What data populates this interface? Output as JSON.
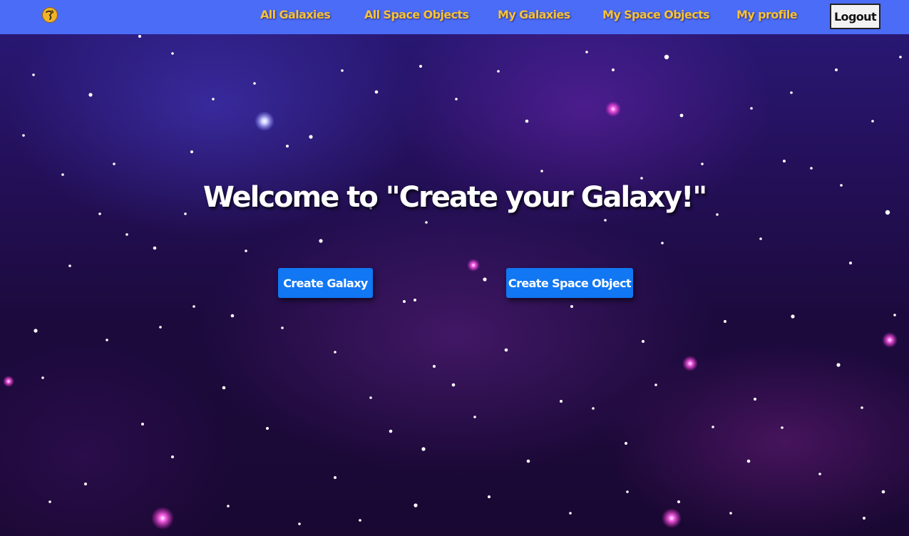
{
  "app": {
    "logo_icon": "globe-icon"
  },
  "nav": {
    "links": [
      {
        "label": "All Galaxies"
      },
      {
        "label": "All Space Objects"
      },
      {
        "label": "My Galaxies"
      },
      {
        "label": "My Space Objects"
      },
      {
        "label": "My profile"
      }
    ],
    "logout_label": "Logout"
  },
  "main": {
    "welcome_title": "Welcome to \"Create your Galaxy!\"",
    "create_galaxy_label": "Create Galaxy",
    "create_space_object_label": "Create Space Object"
  },
  "colors": {
    "navbar_bg": "#4a6cf7",
    "nav_link": "#f3c33a",
    "cta_bg": "#1177f2",
    "logout_bg": "#f2f2f2"
  }
}
